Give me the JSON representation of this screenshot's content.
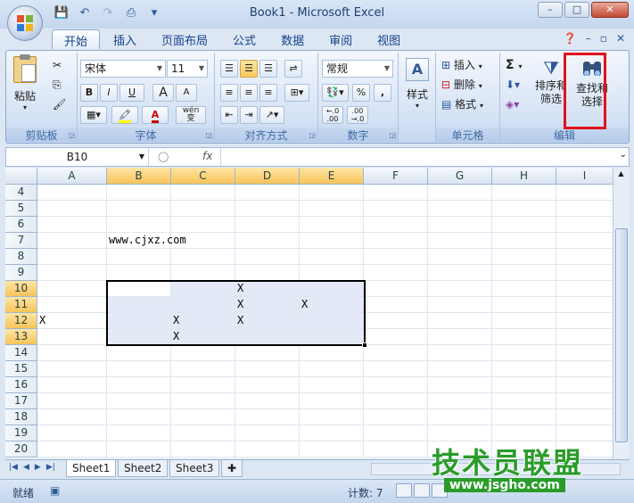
{
  "window": {
    "title": "Book1 - Microsoft Excel",
    "minimize": "–",
    "maximize": "□",
    "close": "✕"
  },
  "qat": {
    "save_icon": "save-icon",
    "undo_icon": "undo-icon",
    "redo_icon": "redo-icon"
  },
  "tabs": [
    "开始",
    "插入",
    "页面布局",
    "公式",
    "数据",
    "审阅",
    "视图"
  ],
  "ribbon": {
    "clipboard": {
      "label": "剪贴板",
      "paste": "粘贴"
    },
    "font": {
      "label": "字体",
      "family": "宋体",
      "size": "11",
      "bold": "B",
      "italic": "I",
      "underline": "U",
      "grow": "A",
      "shrink": "A",
      "wen": "wén\n变"
    },
    "alignment": {
      "label": "对齐方式"
    },
    "number": {
      "label": "数字",
      "format": "常规",
      "percent": "%",
      "comma": ",",
      "inc_dec": ".0\n.00",
      "dec_dec": ".00\n.0"
    },
    "styles": {
      "label": "样式"
    },
    "cells": {
      "label": "单元格",
      "insert": "插入",
      "delete": "删除",
      "format": "格式"
    },
    "editing": {
      "label": "编辑",
      "sum": "Σ",
      "sort_filter": "排序和\n筛选",
      "find_select": "查找和\n选择"
    }
  },
  "formula_bar": {
    "name_box": "B10",
    "fx": "fx",
    "content": ""
  },
  "columns": [
    "A",
    "B",
    "C",
    "D",
    "E",
    "F",
    "G",
    "H",
    "I"
  ],
  "rows": [
    "4",
    "5",
    "6",
    "7",
    "8",
    "9",
    "10",
    "11",
    "12",
    "13",
    "14",
    "15",
    "16",
    "17",
    "18",
    "19",
    "20"
  ],
  "cells": {
    "B7": "www.cjxz.com",
    "D10": "X",
    "D11": "X",
    "E11": "X",
    "A12": "X",
    "C12": "X",
    "D12": "X",
    "C13": "X"
  },
  "sheets": [
    "Sheet1",
    "Sheet2",
    "Sheet3"
  ],
  "status": {
    "ready": "就绪",
    "count": "计数: 7"
  },
  "watermark": {
    "title": "技术员联盟",
    "url": "www.jsgho.com"
  },
  "colors": {
    "highlight": "#e0131c",
    "selection_header": "#f7c35a",
    "ribbon_bg": "#dde7f4"
  }
}
